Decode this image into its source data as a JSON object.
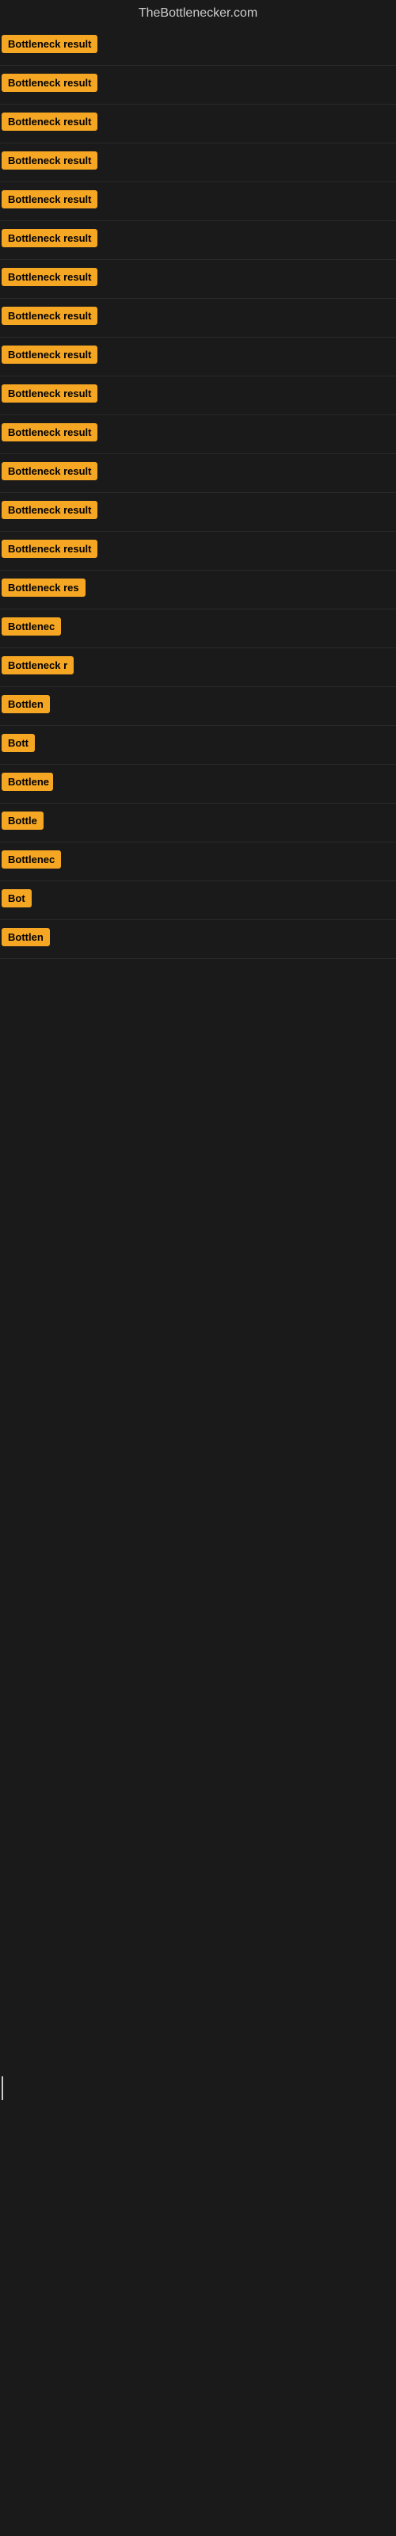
{
  "site": {
    "title": "TheBottlenecker.com"
  },
  "items": [
    {
      "id": 1,
      "label": "Bottleneck result",
      "visible_width": "full"
    },
    {
      "id": 2,
      "label": "Bottleneck result",
      "visible_width": "full"
    },
    {
      "id": 3,
      "label": "Bottleneck result",
      "visible_width": "full"
    },
    {
      "id": 4,
      "label": "Bottleneck result",
      "visible_width": "full"
    },
    {
      "id": 5,
      "label": "Bottleneck result",
      "visible_width": "full"
    },
    {
      "id": 6,
      "label": "Bottleneck result",
      "visible_width": "full"
    },
    {
      "id": 7,
      "label": "Bottleneck result",
      "visible_width": "full"
    },
    {
      "id": 8,
      "label": "Bottleneck result",
      "visible_width": "full"
    },
    {
      "id": 9,
      "label": "Bottleneck result",
      "visible_width": "full"
    },
    {
      "id": 10,
      "label": "Bottleneck result",
      "visible_width": "full"
    },
    {
      "id": 11,
      "label": "Bottleneck result",
      "visible_width": "full"
    },
    {
      "id": 12,
      "label": "Bottleneck result",
      "visible_width": "full"
    },
    {
      "id": 13,
      "label": "Bottleneck result",
      "visible_width": "full"
    },
    {
      "id": 14,
      "label": "Bottleneck result",
      "visible_width": "full"
    },
    {
      "id": 15,
      "label": "Bottleneck res",
      "visible_width": "partial-large"
    },
    {
      "id": 16,
      "label": "Bottlenec",
      "visible_width": "partial-medium"
    },
    {
      "id": 17,
      "label": "Bottleneck r",
      "visible_width": "partial-medium-large"
    },
    {
      "id": 18,
      "label": "Bottlen",
      "visible_width": "partial-small-large"
    },
    {
      "id": 19,
      "label": "Bott",
      "visible_width": "partial-small"
    },
    {
      "id": 20,
      "label": "Bottlene",
      "visible_width": "partial-small-medium"
    },
    {
      "id": 21,
      "label": "Bottle",
      "visible_width": "partial-tiny-large"
    },
    {
      "id": 22,
      "label": "Bottlenec",
      "visible_width": "partial-medium"
    },
    {
      "id": 23,
      "label": "Bot",
      "visible_width": "partial-tiny"
    },
    {
      "id": 24,
      "label": "Bottlen",
      "visible_width": "partial-small-large"
    }
  ],
  "colors": {
    "badge_bg": "#f5a623",
    "badge_text": "#000000",
    "page_bg": "#1a1a1a",
    "title_text": "#cccccc"
  }
}
